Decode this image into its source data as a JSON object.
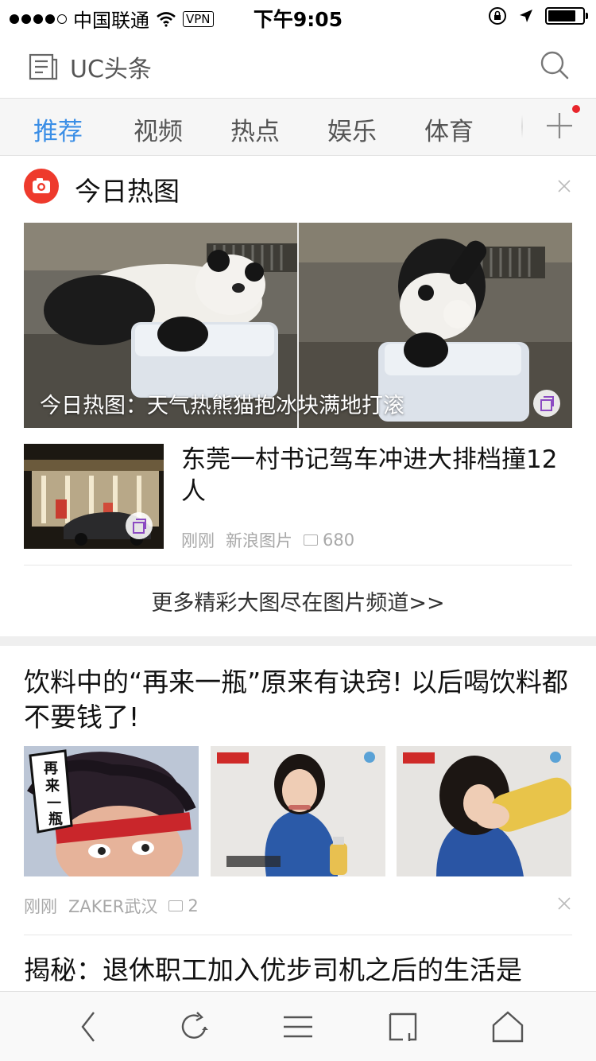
{
  "status_bar": {
    "carrier": "中国联通",
    "vpn": "VPN",
    "time": "下午9:05"
  },
  "header": {
    "title": "UC头条"
  },
  "tabs": [
    {
      "label": "推荐",
      "active": true
    },
    {
      "label": "视频",
      "active": false
    },
    {
      "label": "热点",
      "active": false
    },
    {
      "label": "娱乐",
      "active": false
    },
    {
      "label": "体育",
      "active": false
    }
  ],
  "hot_pics": {
    "title": "今日热图",
    "banner_caption": "今日热图：天气热熊猫抱冰块满地打滚",
    "news": {
      "title": "东莞一村书记驾车冲进大排档撞12人",
      "time": "刚刚",
      "source": "新浪图片",
      "comments": "680"
    },
    "more_link": "更多精彩大图尽在图片频道>>"
  },
  "article1": {
    "title": "饮料中的“再来一瓶”原来有诀窍! 以后喝饮料都不要钱了!",
    "time": "刚刚",
    "source": "ZAKER武汉",
    "comments": "2",
    "thumb_text": "再来一瓶啊"
  },
  "article2": {
    "title": "揭秘：退休职工加入优步司机之后的生活是"
  },
  "colors": {
    "accent": "#3a8ee6",
    "brand_red": "#ee3a2c",
    "meta_gray": "#a8a8a8"
  }
}
